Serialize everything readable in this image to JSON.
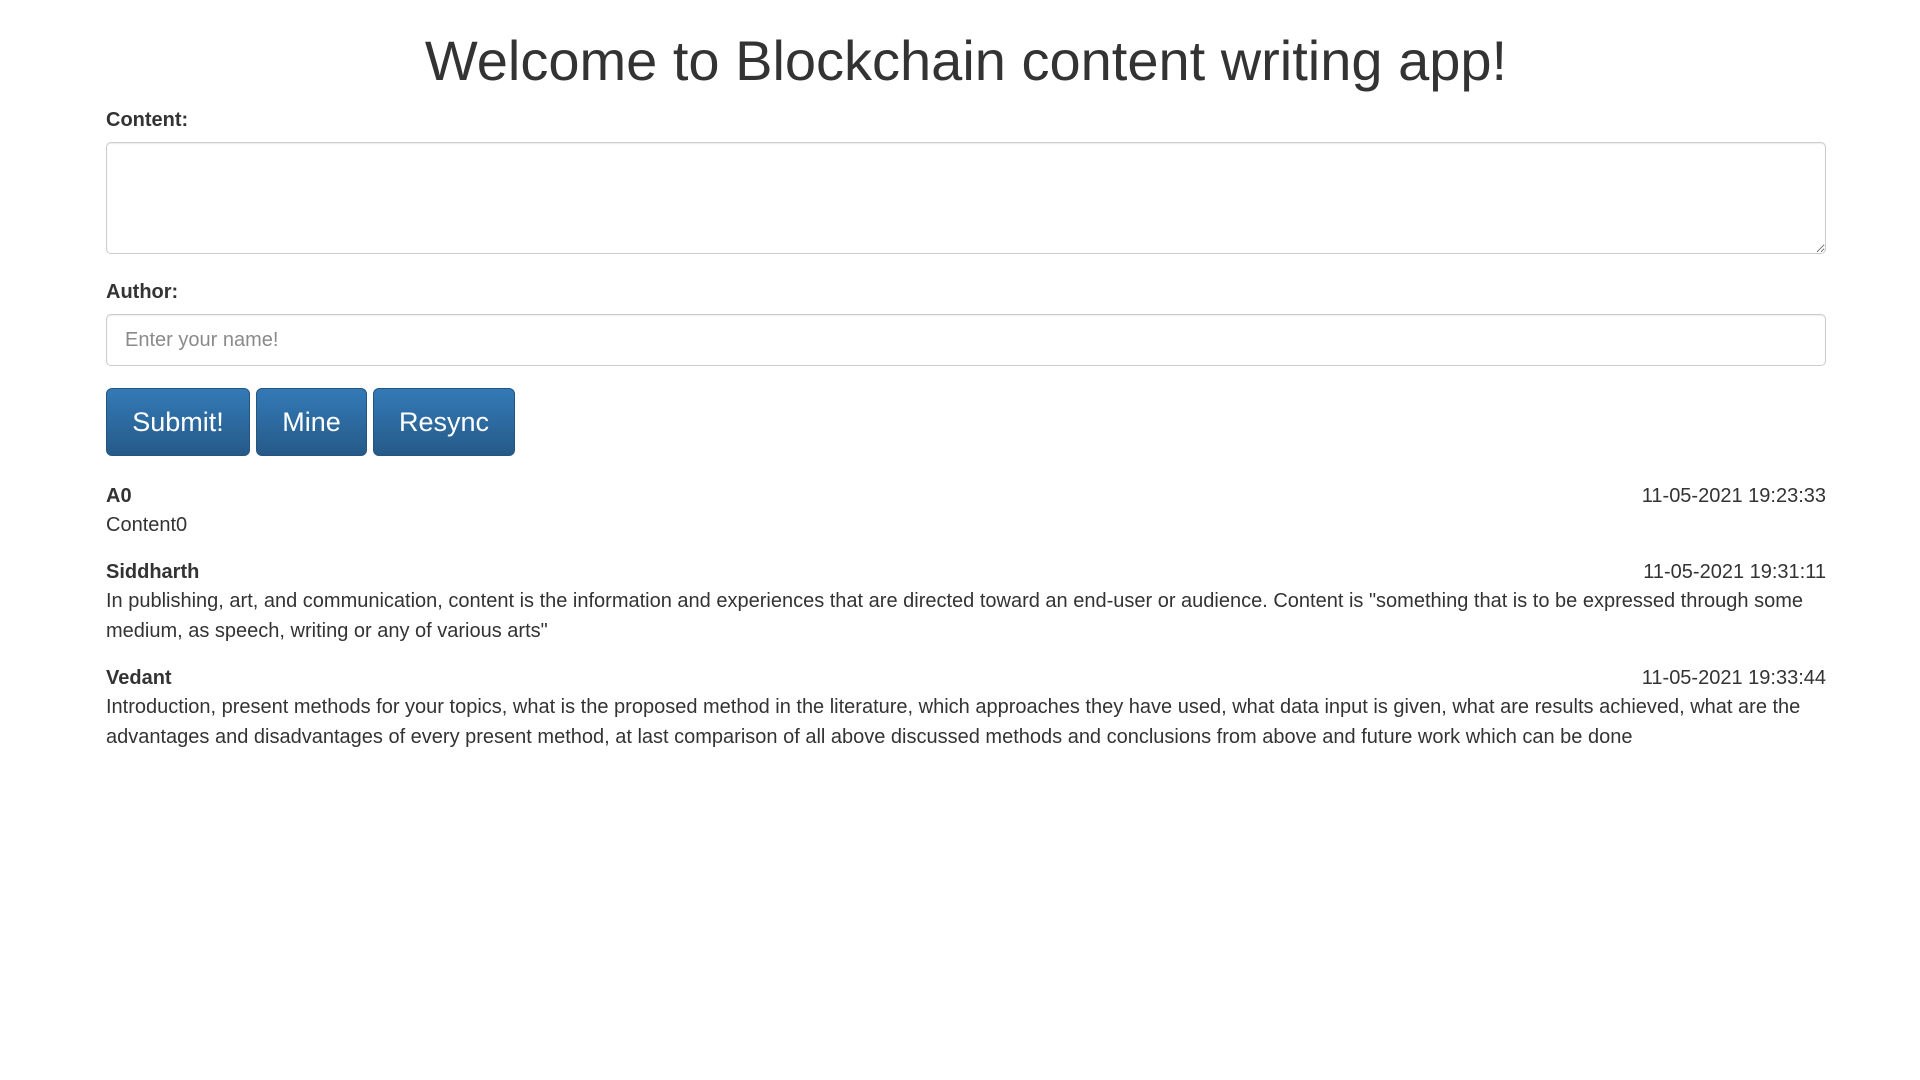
{
  "page": {
    "title": "Welcome to Blockchain content writing app!"
  },
  "form": {
    "content_label": "Content:",
    "content_value": "",
    "author_label": "Author:",
    "author_value": "",
    "author_placeholder": "Enter your name!"
  },
  "buttons": {
    "submit_label": "Submit!",
    "mine_label": "Mine",
    "resync_label": "Resync"
  },
  "posts": [
    {
      "author": "A0",
      "timestamp": "11-05-2021 19:23:33",
      "content": "Content0"
    },
    {
      "author": "Siddharth",
      "timestamp": "11-05-2021 19:31:11",
      "content": "In publishing, art, and communication, content is the information and experiences that are directed toward an end-user or audience. Content is \"something that is to be expressed through some medium, as speech, writing or any of various arts\""
    },
    {
      "author": "Vedant",
      "timestamp": "11-05-2021 19:33:44",
      "content": "Introduction, present methods for your topics, what is the proposed method in the literature, which approaches they have used, what data input is given, what are results achieved, what are the advantages and disadvantages of every present method, at last comparison of all above discussed methods and conclusions from above and future work which can be done"
    }
  ],
  "colors": {
    "button_top": "#337ab7",
    "button_bottom": "#265a88",
    "text": "#333333",
    "input_border": "#cccccc"
  }
}
